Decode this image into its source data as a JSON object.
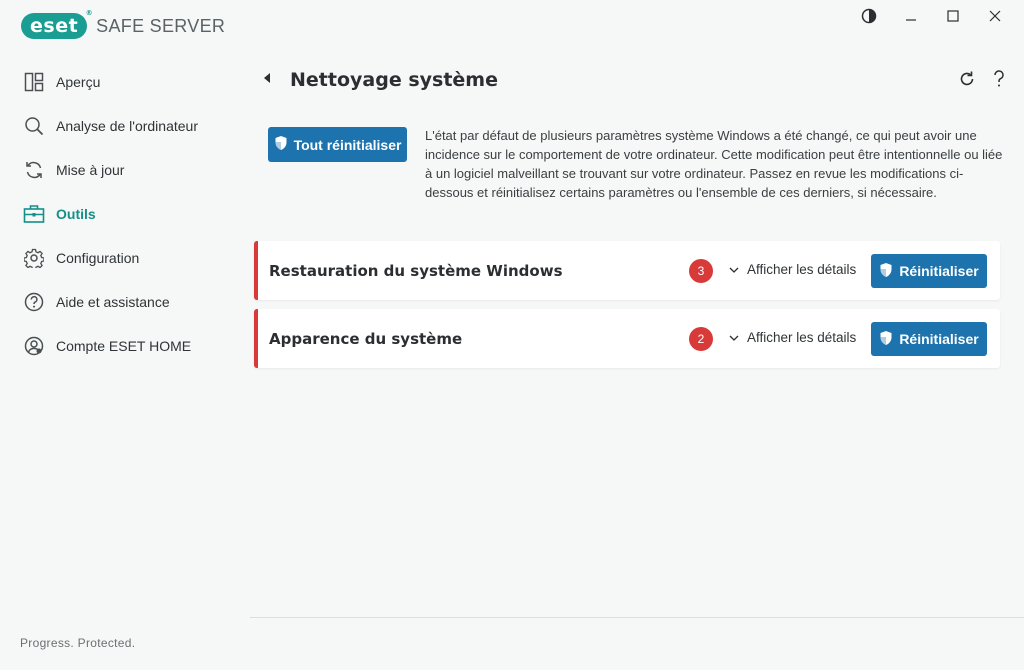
{
  "brand": {
    "logo": "eset",
    "product": "SAFE SERVER",
    "reg": "®"
  },
  "nav": [
    {
      "label": "Aperçu",
      "icon": "overview-icon",
      "active": false
    },
    {
      "label": "Analyse de l'ordinateur",
      "icon": "search-icon",
      "active": false
    },
    {
      "label": "Mise à jour",
      "icon": "refresh-icon",
      "active": false
    },
    {
      "label": "Outils",
      "icon": "toolbox-icon",
      "active": true
    },
    {
      "label": "Configuration",
      "icon": "gear-icon",
      "active": false
    },
    {
      "label": "Aide et assistance",
      "icon": "help-icon",
      "active": false
    },
    {
      "label": "Compte ESET HOME",
      "icon": "account-icon",
      "active": false
    }
  ],
  "footer": "Progress. Protected.",
  "page": {
    "title": "Nettoyage système",
    "reset_all_label": "Tout réinitialiser",
    "description": "L'état par défaut de plusieurs paramètres système Windows a été changé, ce qui peut avoir une incidence sur le comportement de votre ordinateur. Cette modification peut être intentionnelle ou liée à un logiciel malveillant se trouvant sur votre ordinateur. Passez en revue les modifications ci-dessous et réinitialisez certains paramètres ou l'ensemble de ces derniers, si nécessaire."
  },
  "items": [
    {
      "title": "Restauration du système Windows",
      "count": "3",
      "details_label": "Afficher les détails",
      "reset_label": "Réinitialiser"
    },
    {
      "title": "Apparence du système",
      "count": "2",
      "details_label": "Afficher les détails",
      "reset_label": "Réinitialiser"
    }
  ],
  "colors": {
    "accent": "#158f89",
    "primary": "#1d73ad",
    "alert": "#d83a3a",
    "brand": "#1a9e94"
  }
}
